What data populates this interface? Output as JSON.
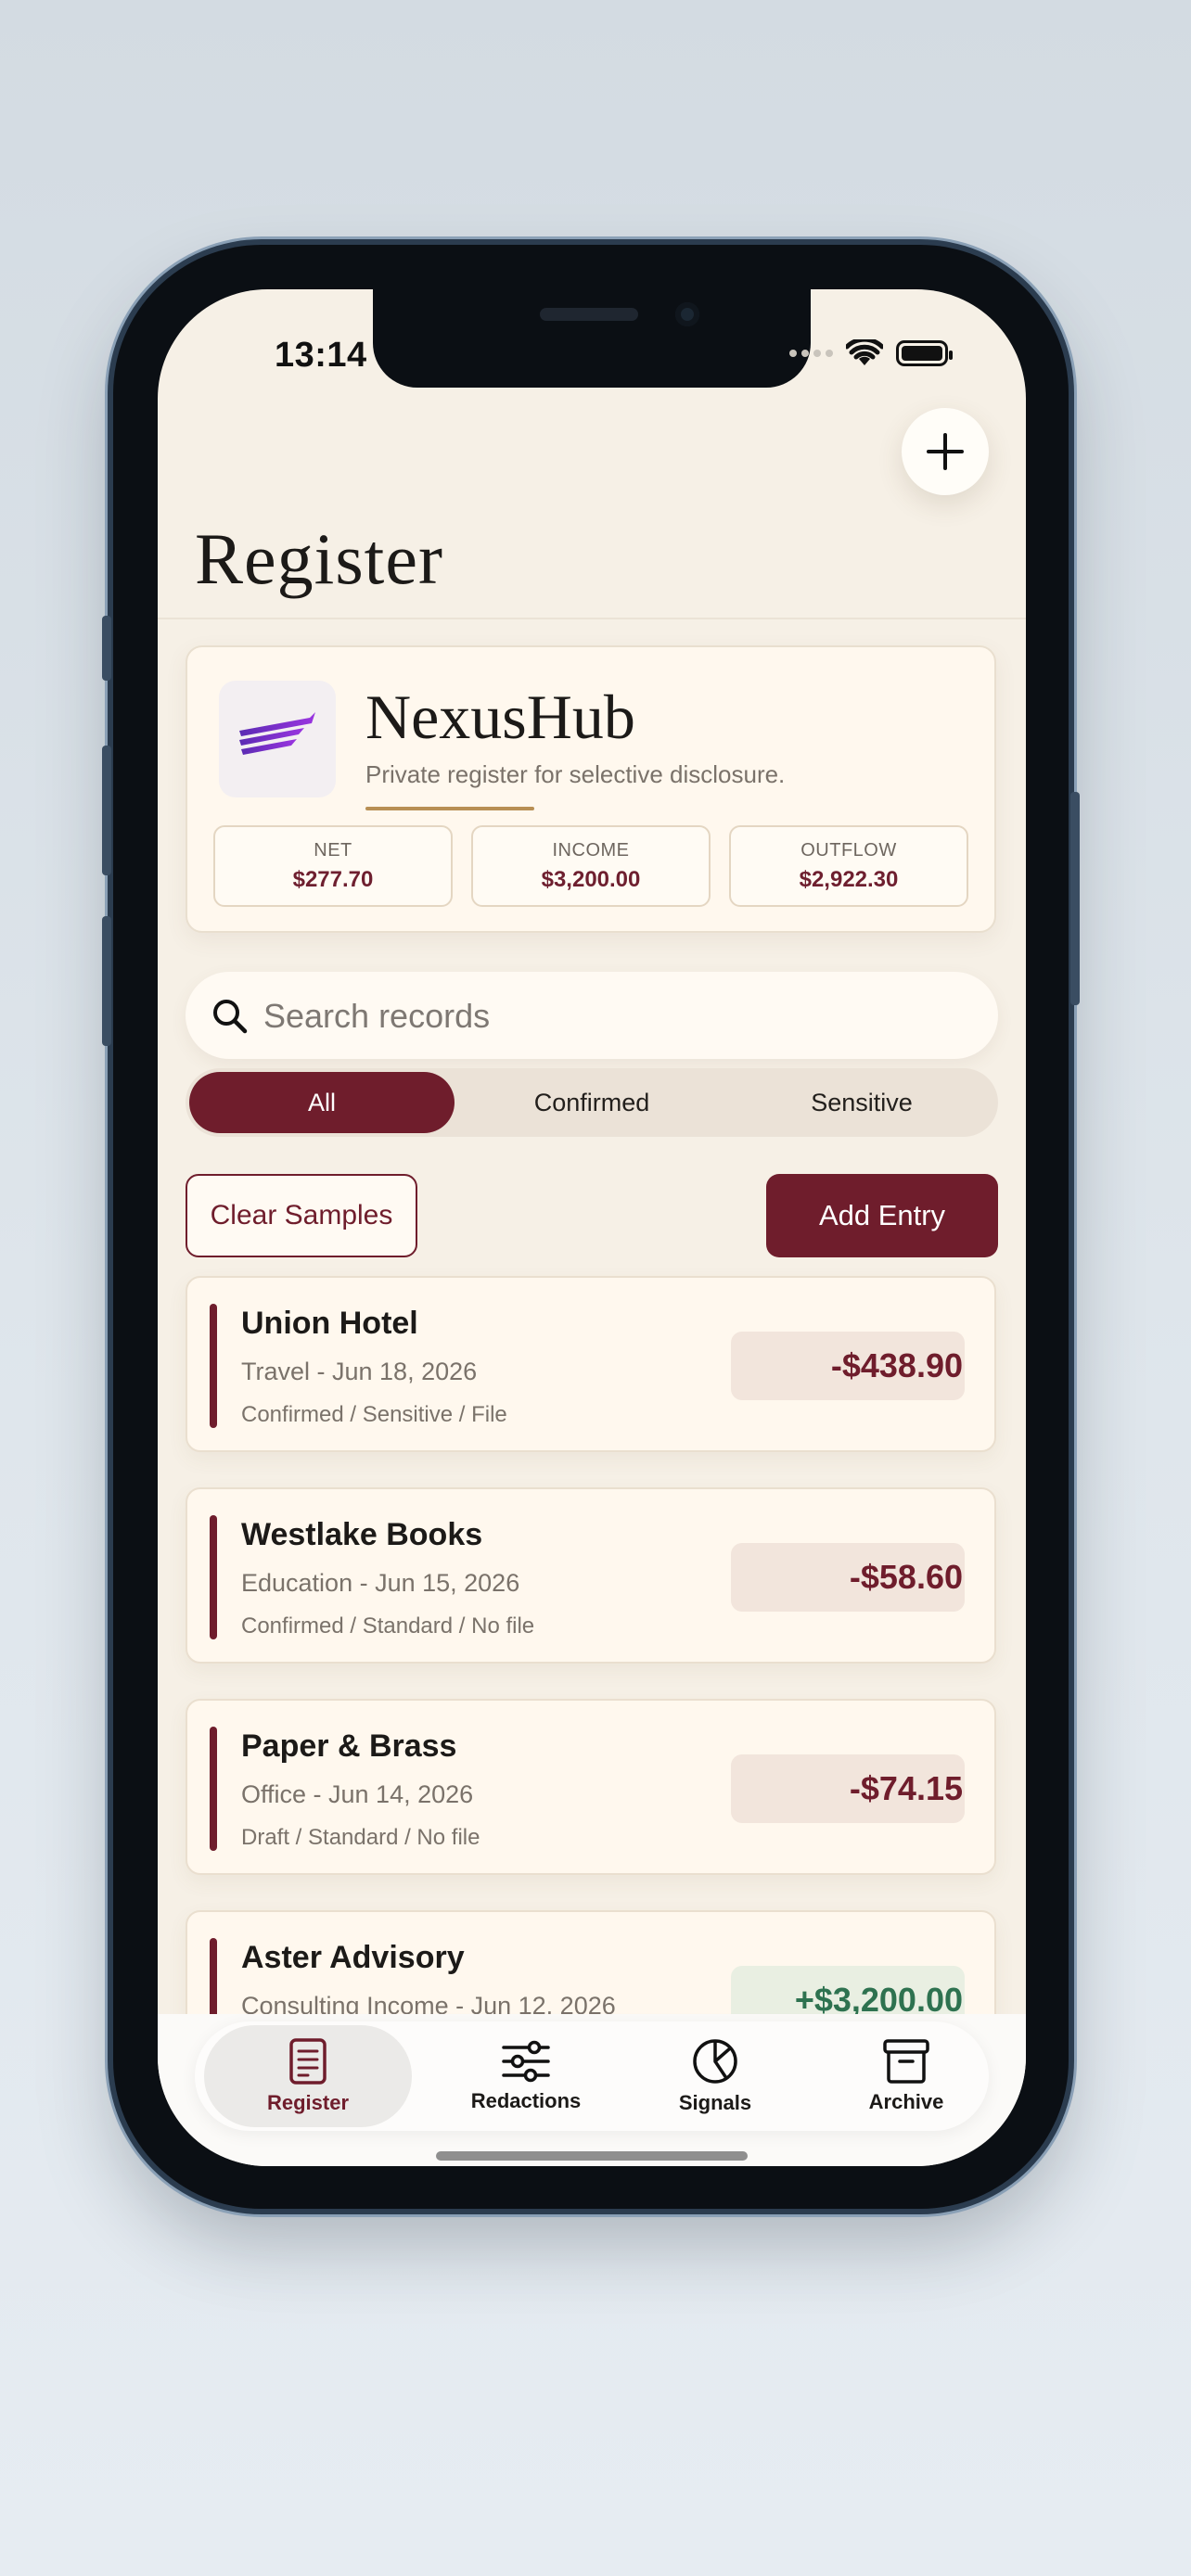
{
  "status_bar": {
    "time": "13:14"
  },
  "header": {
    "title": "Register",
    "add_icon": "plus-icon"
  },
  "profile": {
    "name": "NexusHub",
    "subtitle": "Private register for selective disclosure.",
    "stats": [
      {
        "label": "NET",
        "value": "$277.70"
      },
      {
        "label": "INCOME",
        "value": "$3,200.00"
      },
      {
        "label": "OUTFLOW",
        "value": "$2,922.30"
      }
    ]
  },
  "search": {
    "placeholder": "Search records",
    "value": ""
  },
  "filters": {
    "options": [
      "All",
      "Confirmed",
      "Sensitive"
    ],
    "selected": "All"
  },
  "actions": {
    "clear_label": "Clear Samples",
    "add_label": "Add Entry"
  },
  "entries": [
    {
      "title": "Union Hotel",
      "subtitle": "Travel - Jun 18, 2026",
      "meta": "Confirmed / Sensitive / File",
      "amount": "-$438.90"
    },
    {
      "title": "Westlake Books",
      "subtitle": "Education - Jun 15, 2026",
      "meta": "Confirmed / Standard / No file",
      "amount": "-$58.60"
    },
    {
      "title": "Paper & Brass",
      "subtitle": "Office - Jun 14, 2026",
      "meta": "Draft / Standard / No file",
      "amount": "-$74.15"
    },
    {
      "title": "Aster Advisory",
      "subtitle": "Consulting Income - Jun 12, 2026",
      "meta": "",
      "amount": "+$3,200.00"
    }
  ],
  "tabs": [
    {
      "label": "Register",
      "icon": "ledger-icon",
      "active": true
    },
    {
      "label": "Redactions",
      "icon": "sliders-icon",
      "active": false
    },
    {
      "label": "Signals",
      "icon": "pie-chart-icon",
      "active": false
    },
    {
      "label": "Archive",
      "icon": "archive-box-icon",
      "active": false
    }
  ],
  "colors": {
    "accent": "#6f1d2c",
    "background": "#f6f0e6",
    "positive": "#2e7250",
    "gold": "#b88f54"
  }
}
